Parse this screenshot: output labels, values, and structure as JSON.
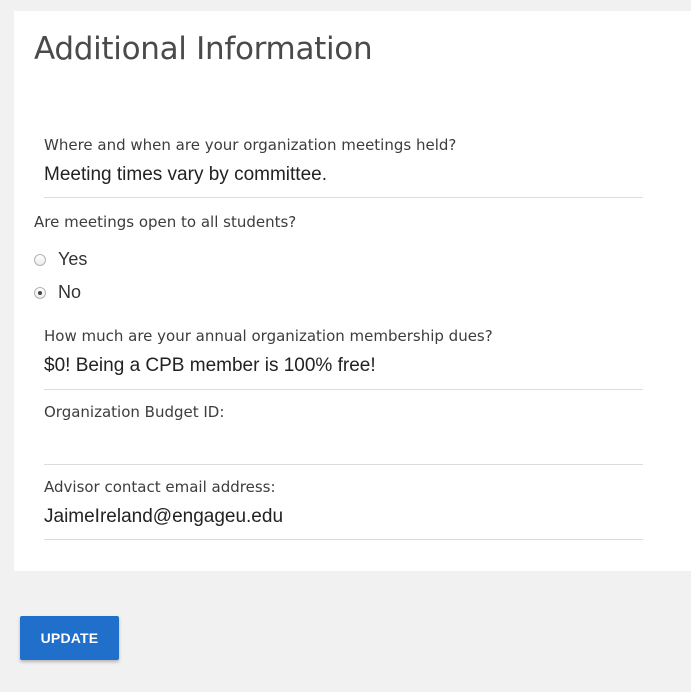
{
  "section": {
    "title": "Additional Information"
  },
  "fields": {
    "meetings": {
      "label": "Where and when are your organization meetings held?",
      "value": "Meeting times vary by committee."
    },
    "dues": {
      "label": "How much are your annual organization membership dues?",
      "value": "$0! Being a CPB member is 100% free!"
    },
    "budget": {
      "label": "Organization Budget ID:",
      "value": ""
    },
    "advisor_email": {
      "label": "Advisor contact email address:",
      "value": "JaimeIreland@engageu.edu"
    }
  },
  "open_meetings": {
    "question": "Are meetings open to all students?",
    "options": [
      {
        "label": "Yes",
        "selected": false
      },
      {
        "label": "No",
        "selected": true
      }
    ]
  },
  "actions": {
    "update_label": "UPDATE"
  },
  "colors": {
    "page_background": "#f1f1f1",
    "card_background": "#ffffff",
    "button_background": "#1f6fcb",
    "divider": "#dcdcdc"
  }
}
